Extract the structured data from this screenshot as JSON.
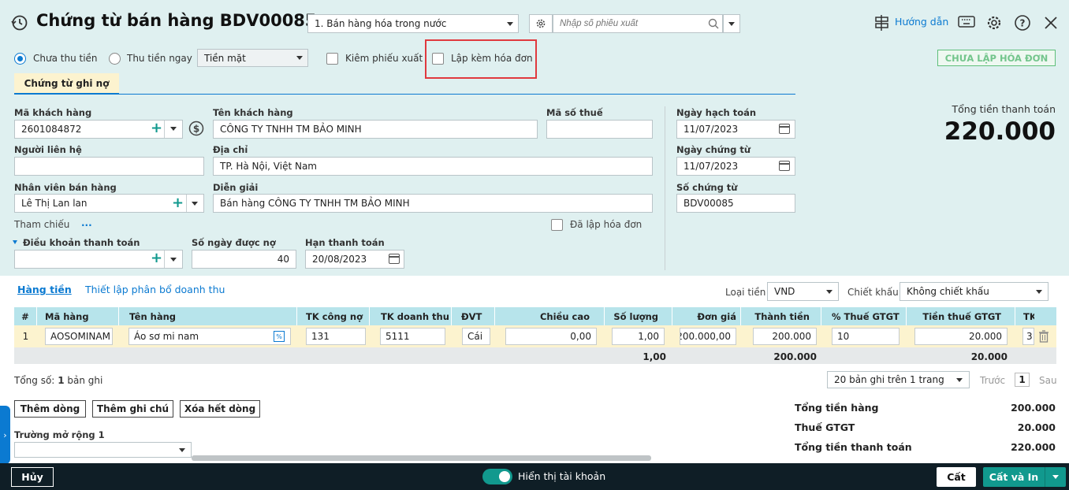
{
  "header": {
    "title": "Chứng từ bán hàng BDV00085",
    "sale_type": "1. Bán hàng hóa trong nước",
    "search_placeholder": "Nhập số phiếu xuất",
    "help_label": "Hướng dẫn"
  },
  "options": {
    "radio_unpaid": "Chưa thu tiền",
    "radio_paid": "Thu tiền ngay",
    "payment_method": "Tiền mặt",
    "check_delivery": "Kiêm phiếu xuất",
    "check_invoice": "Lập kèm hóa đơn",
    "status_button": "CHƯA LẬP HÓA ĐƠN"
  },
  "tab": {
    "label": "Chứng từ ghi nợ"
  },
  "form": {
    "customer_code_label": "Mã khách hàng",
    "customer_code": "2601084872",
    "customer_name_label": "Tên khách hàng",
    "customer_name": "CÔNG TY TNHH TM BẢO MINH",
    "tax_code_label": "Mã số thuế",
    "tax_code": "",
    "contact_label": "Người liên hệ",
    "contact": "",
    "address_label": "Địa chỉ",
    "address": "TP. Hà Nội, Việt Nam",
    "salesperson_label": "Nhân viên bán hàng",
    "salesperson": "Lê Thị Lan lan",
    "description_label": "Diễn giải",
    "description": "Bán hàng CÔNG TY TNHH TM BẢO MINH",
    "reference_label": "Tham chiếu",
    "reference_more": "...",
    "invoiced_label": "Đã lập hóa đơn",
    "terms_label": "Điều khoản thanh toán",
    "terms": "",
    "days_label": "Số ngày được nợ",
    "days": "40",
    "due_label": "Hạn thanh toán",
    "due_date": "20/08/2023",
    "posting_date_label": "Ngày hạch toán",
    "posting_date": "11/07/2023",
    "voucher_date_label": "Ngày chứng từ",
    "voucher_date": "11/07/2023",
    "voucher_no_label": "Số chứng từ",
    "voucher_no": "BDV00085"
  },
  "total": {
    "label": "Tổng tiền thanh toán",
    "value": "220.000"
  },
  "grid_tabs": {
    "goods": "Hàng tiền",
    "revenue": "Thiết lập phân bổ doanh thu"
  },
  "currency": {
    "label": "Loại tiền",
    "value": "VND"
  },
  "discount": {
    "label": "Chiết khấu",
    "value": "Không chiết khấu"
  },
  "table": {
    "headers": [
      "#",
      "Mã hàng",
      "Tên hàng",
      "TK công nợ",
      "TK doanh thu",
      "ĐVT",
      "Chiều cao",
      "Số lượng",
      "Đơn giá",
      "Thành tiền",
      "% Thuế GTGT",
      "Tiền thuế GTGT",
      "TK"
    ],
    "row": [
      "1",
      "AOSOMINAM",
      "Áo sơ mi nam",
      "131",
      "5111",
      "Cái",
      "0,00",
      "1,00",
      "200.000,00",
      "200.000",
      "10",
      "20.000",
      "3"
    ],
    "footer": {
      "quantity": "1,00",
      "amount": "200.000",
      "tax": "20.000"
    }
  },
  "pager": {
    "count_prefix": "Tổng số:",
    "count_value": "1",
    "count_suffix": "bản ghi",
    "per_page": "20 bản ghi trên 1 trang",
    "prev": "Trước",
    "page": "1",
    "next": "Sau"
  },
  "actions": {
    "add_row": "Thêm dòng",
    "add_note": "Thêm ghi chú",
    "delete_all": "Xóa hết dòng"
  },
  "extension": {
    "label": "Trường mở rộng 1",
    "value": ""
  },
  "summary": {
    "goods_label": "Tổng tiền hàng",
    "goods_value": "200.000",
    "vat_label": "Thuế GTGT",
    "vat_value": "20.000",
    "total_label": "Tổng tiền thanh toán",
    "total_value": "220.000"
  },
  "bottom": {
    "cancel": "Hủy",
    "show_accounts": "Hiển thị tài khoản",
    "save": "Cất",
    "save_print": "Cất và In"
  },
  "colors": {
    "accent": "#0b7ad1",
    "teal": "#11998e",
    "header_bg": "#dff0f0",
    "grid_header": "#b7e4eb",
    "highlight": "#e0393e"
  }
}
